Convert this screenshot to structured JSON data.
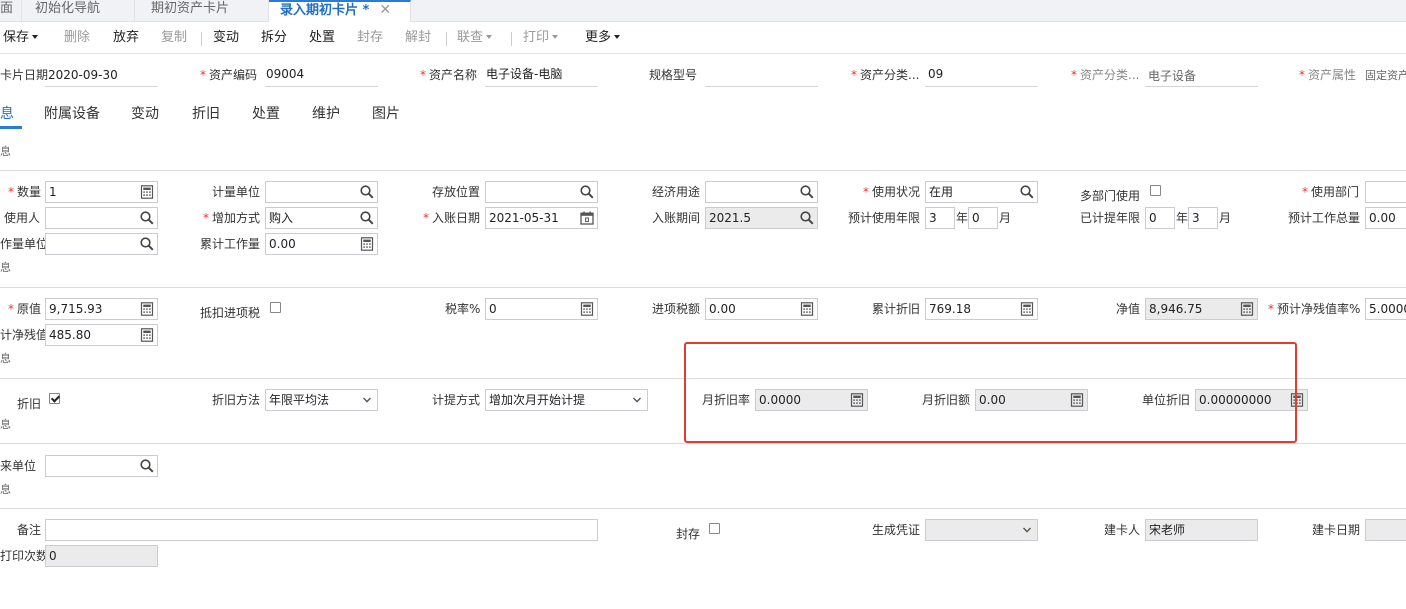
{
  "tabs": [
    "面",
    "初始化导航",
    "期初资产卡片",
    "录入期初卡片 *"
  ],
  "tab_close": "✕",
  "toolbar": {
    "save": "保存",
    "delete": "删除",
    "discard": "放弃",
    "copy": "复制",
    "change": "变动",
    "split": "拆分",
    "dispose": "处置",
    "seal": "封存",
    "unseal": "解封",
    "linked": "联查",
    "print": "打印",
    "more": "更多"
  },
  "header": {
    "card_date_label": "卡片日期",
    "card_date": "2020-09-30",
    "code_label": "资产编码",
    "code": "09004",
    "name_label": "资产名称",
    "name": "电子设备-电脑",
    "spec_label": "规格型号",
    "spec": "",
    "cat_code_label": "资产分类...",
    "cat_code": "09",
    "cat_name_label": "资产分类...",
    "cat_name": "电子设备",
    "attr_label": "资产属性",
    "attr": "固定资产"
  },
  "subtabs": [
    "息",
    "附属设备",
    "变动",
    "折旧",
    "处置",
    "维护",
    "图片"
  ],
  "sections": {
    "s1": "息",
    "s2": "息",
    "s3": "息",
    "s4": "息",
    "s5": "息"
  },
  "basic": {
    "qty_label": "数量",
    "qty": "1",
    "unit_label": "计量单位",
    "unit": "",
    "location_label": "存放位置",
    "location": "",
    "purpose_label": "经济用途",
    "purpose": "",
    "status_label": "使用状况",
    "status": "在用",
    "multi_dept_label": "多部门使用",
    "dept_label": "使用部门",
    "dept": "",
    "user_label": "使用人",
    "user": "",
    "add_method_label": "增加方式",
    "add_method": "购入",
    "entry_date_label": "入账日期",
    "entry_date": "2021-05-31",
    "entry_period_label": "入账期间",
    "entry_period": "2021.5",
    "life_label": "预计使用年限",
    "life_years": "3",
    "life_months": "0",
    "year_unit": "年",
    "month_unit": "月",
    "accrued_label": "已计提年限",
    "accrued_years": "0",
    "accrued_months": "3",
    "workload_label": "预计工作总量",
    "workload": "0.00",
    "work_unit_label": "作量单位",
    "work_unit": "",
    "cum_work_label": "累计工作量",
    "cum_work": "0.00"
  },
  "value": {
    "original_label": "原值",
    "original": "9,715.93",
    "deduct_label": "抵扣进项税",
    "tax_rate_label": "税率%",
    "tax_rate": "0",
    "input_tax_label": "进项税额",
    "input_tax": "0.00",
    "cum_dep_label": "累计折旧",
    "cum_dep": "769.18",
    "net_label": "净值",
    "net": "8,946.75",
    "residual_rate_label": "预计净残值率%",
    "residual_rate": "5.0000",
    "residual_label": "计净残值",
    "residual": "485.80"
  },
  "depreciation": {
    "dep_label": "折旧",
    "method_label": "折旧方法",
    "method": "年限平均法",
    "accrual_label": "计提方式",
    "accrual": "增加次月开始计提",
    "monthly_rate_label": "月折旧率",
    "monthly_rate": "0.0000",
    "monthly_amount_label": "月折旧额",
    "monthly_amount": "0.00",
    "unit_dep_label": "单位折旧",
    "unit_dep": "0.00000000"
  },
  "other": {
    "contact_label": "来单位",
    "contact": "",
    "note_label": "备注",
    "note": "",
    "sealed_label": "封存",
    "voucher_label": "生成凭证",
    "voucher": "",
    "creator_label": "建卡人",
    "creator": "宋老师",
    "create_date_label": "建卡日期",
    "create_date": "",
    "print_count_label": "打印次数",
    "print_count": "0"
  },
  "colors": {
    "accent": "#2a7bd5",
    "highlight_box": "#e23b30",
    "required": "#e33333"
  }
}
